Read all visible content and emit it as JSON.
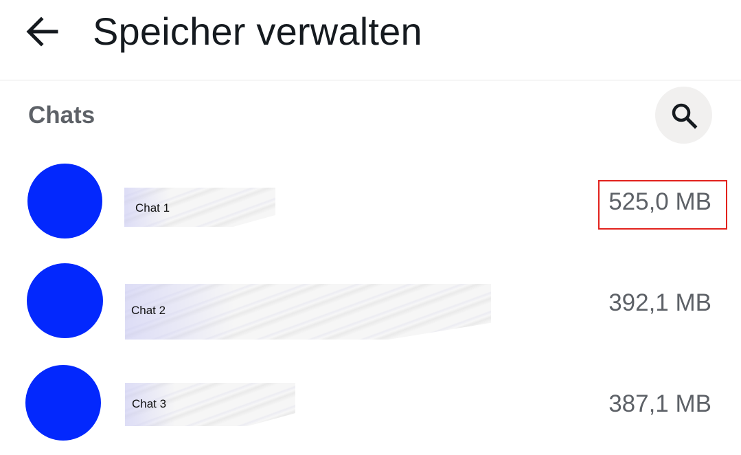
{
  "header": {
    "title": "Speicher verwalten",
    "back_icon": "arrow-left-icon"
  },
  "section": {
    "title": "Chats",
    "search_icon": "search-icon"
  },
  "chats": [
    {
      "name": "Chat 1",
      "size": "525,0 MB",
      "highlighted": true
    },
    {
      "name": "Chat 2",
      "size": "392,1 MB",
      "highlighted": false
    },
    {
      "name": "Chat 3",
      "size": "387,1 MB",
      "highlighted": false
    }
  ],
  "colors": {
    "avatar": "#0328fd",
    "title": "#151a1f",
    "secondary_text": "#5d6167",
    "highlight": "#e2211c"
  }
}
